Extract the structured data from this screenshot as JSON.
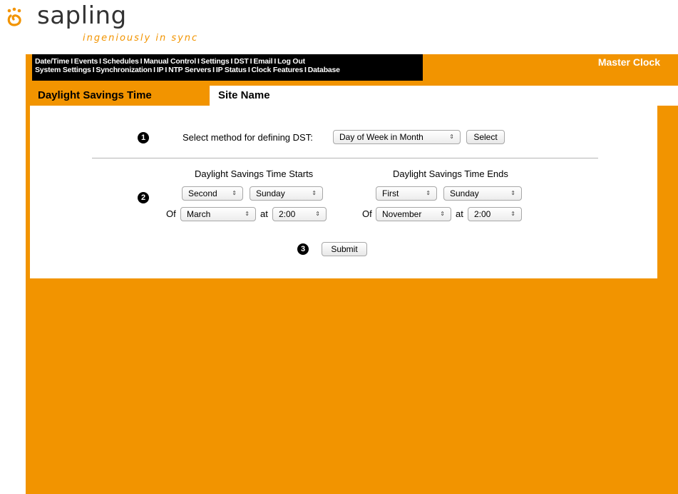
{
  "logo": {
    "brand": "sapling",
    "tagline": "ingeniously in sync"
  },
  "colors": {
    "accent": "#f29400",
    "nav_bg": "#000000"
  },
  "nav": {
    "row1": [
      "Date/Time",
      "Events",
      "Schedules",
      "Manual Control",
      "Settings",
      "DST",
      "Email",
      "Log Out"
    ],
    "row2": [
      "System Settings",
      "Synchronization",
      "IP",
      "NTP Servers",
      "IP Status",
      "Clock Features",
      "Database"
    ],
    "separator": "I"
  },
  "header": {
    "master_clock": "Master Clock",
    "page_title": "Daylight Savings Time",
    "site_name": "Site Name"
  },
  "step1": {
    "number": "1",
    "label": "Select method for defining DST:",
    "method": "Day of Week in Month",
    "select_button": "Select"
  },
  "step2": {
    "number": "2",
    "starts": {
      "heading": "Daylight Savings Time Starts",
      "week": "Second",
      "day": "Sunday",
      "of_label": "Of",
      "month": "March",
      "at_label": "at",
      "time": "2:00"
    },
    "ends": {
      "heading": "Daylight Savings Time Ends",
      "week": "First",
      "day": "Sunday",
      "of_label": "Of",
      "month": "November",
      "at_label": "at",
      "time": "2:00"
    }
  },
  "step3": {
    "number": "3",
    "submit": "Submit"
  },
  "icons": {
    "dropdown": "updown-arrows-icon",
    "logo": "sapling-logo-icon",
    "step_number": "numbered-circle-icon"
  }
}
